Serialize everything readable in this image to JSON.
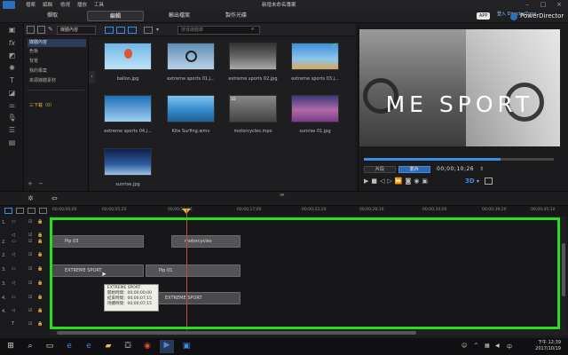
{
  "menu": [
    "檔案",
    "編輯",
    "檢視",
    "播放",
    "工具"
  ],
  "window_title": "新增未命名專案",
  "tabs": [
    "擷取",
    "編輯",
    "輸出檔案",
    "製作光碟"
  ],
  "account": {
    "badge": "APP",
    "link": "登入 DirectorZone",
    "app_name": "PowerDirector"
  },
  "library": {
    "dropdown": "媒體內容",
    "search_placeholder": "搜尋媒體庫",
    "categories": [
      "媒體內容",
      "色板",
      "背景",
      "我的專案",
      "來源媒體素材"
    ],
    "tag_label": "三下載（0）",
    "items": [
      {
        "name": "ballon.jpg"
      },
      {
        "name": "extreme sports 01.j..."
      },
      {
        "name": "extreme sports 02.jpg"
      },
      {
        "name": "extreme sports 03.j..."
      },
      {
        "name": "extreme sports 04.j..."
      },
      {
        "name": "Kite Surfing.wmv"
      },
      {
        "name": "motorcycles.mpo"
      },
      {
        "name": "sunrise 01.jpg"
      },
      {
        "name": "sunrise.jpg"
      }
    ]
  },
  "preview": {
    "title_text": "ME SPORT",
    "mode_clip": "片段",
    "mode_movie": "影片",
    "timecode": "00;00;10;26",
    "progress": 0.72
  },
  "ruler_ticks": [
    "00;00;00;00",
    "00;00;05;20",
    "00;00;11;10",
    "00;00;17;00",
    "00;00;22;20",
    "00;00;28;10",
    "00;00;34;00",
    "00;00;39;20",
    "00;00;45;10",
    "00;00;51;00",
    "00;00;56;20"
  ],
  "tracks": [
    {
      "label": "1."
    },
    {
      "label": "2."
    },
    {
      "label": "2."
    },
    {
      "label": "3."
    },
    {
      "label": "3."
    },
    {
      "label": "4."
    },
    {
      "label": "4."
    },
    {
      "label": "T"
    },
    {
      "label": "♪"
    }
  ],
  "clips": {
    "pip03": "Pip 03",
    "motorcycles": "motorcycles",
    "extreme_sport": "EXTREME SPORT",
    "pip01": "Pip 01",
    "extreme_sport_2": "EXTREME SPORT"
  },
  "tooltip": {
    "line1": "EXTREME SPORT",
    "line2": "開始時間：00;00;00;00",
    "line3": "結束時間：00;00;07;15",
    "line4": "持續時間：00;00;07;15"
  },
  "taskbar": {
    "time": "下午 12:39",
    "date": "2017/10/19"
  },
  "colors": {
    "highlight": "#25e01b",
    "accent": "#3a8ee6",
    "playhead": "#c24b3b"
  }
}
